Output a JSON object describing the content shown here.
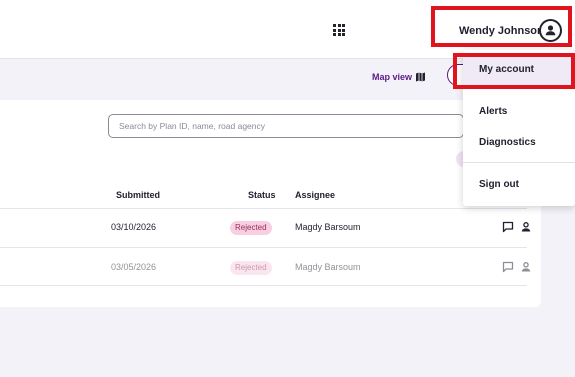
{
  "header": {
    "apps_icon": "apps-grid-icon",
    "user_name": "Wendy Johnson",
    "avatar_icon": "person-circle-icon"
  },
  "toolbar": {
    "map_view_label": "Map view",
    "map_icon": "map-icon"
  },
  "search": {
    "placeholder": "Search by Plan ID, name, road agency"
  },
  "table": {
    "columns": [
      "Submitted",
      "Status",
      "Assignee"
    ],
    "rows": [
      {
        "submitted": "03/10/2026",
        "status": "Rejected",
        "assignee": "Magdy Barsoum",
        "icons": [
          "comment-icon",
          "person-icon"
        ]
      },
      {
        "submitted": "03/05/2026",
        "status": "Rejected",
        "assignee": "Magdy Barsoum",
        "icons": [
          "comment-icon",
          "person-icon"
        ]
      }
    ]
  },
  "user_menu": {
    "items": [
      "My account",
      "Alerts",
      "Diagnostics",
      "Sign out"
    ],
    "active": "My account"
  },
  "colors": {
    "accent": "#5b1a87",
    "highlight": "#e0141c",
    "badge_bg": "#f7cfe0",
    "badge_text": "#9b2d59"
  }
}
